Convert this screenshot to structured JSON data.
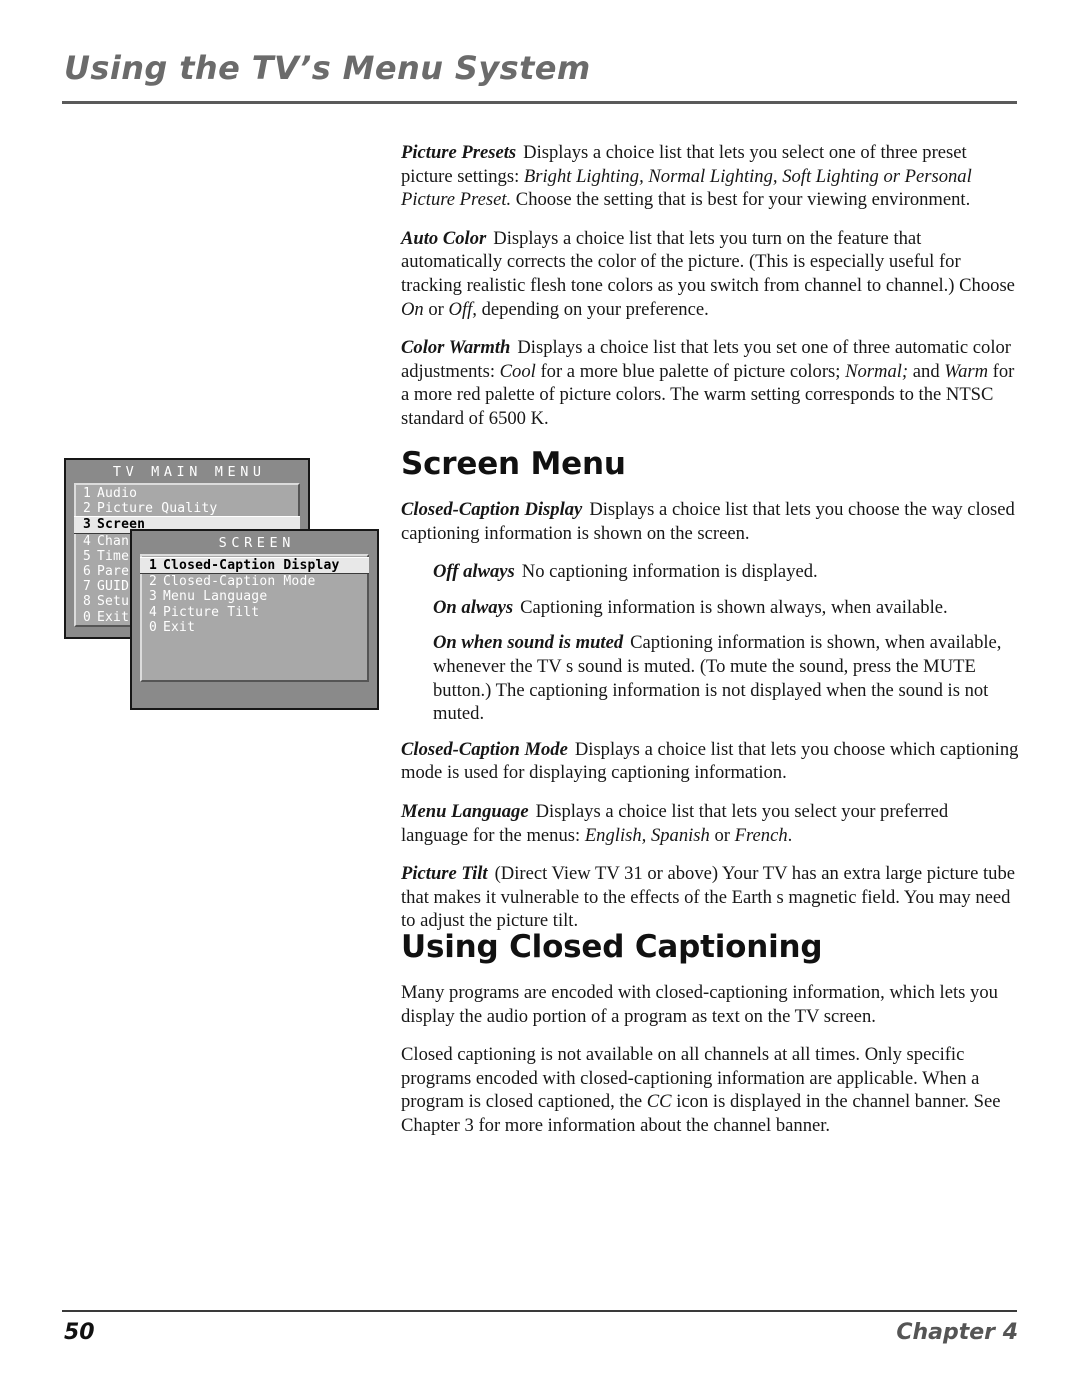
{
  "header": {
    "running_title": "Using the TV’s Menu System"
  },
  "intro_paragraphs": [
    {
      "lead": "Picture Presets",
      "runs": [
        {
          "text": "Displays a choice list that lets you select one of three preset picture settings: ",
          "style": "normal"
        },
        {
          "text": "Bright Lighting, Normal Lighting, Soft Lighting or Personal Picture Preset.",
          "style": "italic"
        },
        {
          "text": " Choose the setting that is best for your viewing environment.",
          "style": "normal"
        }
      ]
    },
    {
      "lead": "Auto Color",
      "runs": [
        {
          "text": "Displays a choice list that lets you turn on the feature that automatically corrects the color of the picture. (This is especially useful for tracking realistic flesh tone colors as you switch from channel to channel.) Choose ",
          "style": "normal"
        },
        {
          "text": "On",
          "style": "italic"
        },
        {
          "text": " or ",
          "style": "normal"
        },
        {
          "text": "Off,",
          "style": "italic"
        },
        {
          "text": " depending on your preference.",
          "style": "normal"
        }
      ]
    },
    {
      "lead": "Color Warmth",
      "runs": [
        {
          "text": "Displays a choice list that lets you set one of three automatic color adjustments: ",
          "style": "normal"
        },
        {
          "text": "Cool",
          "style": "italic"
        },
        {
          "text": " for a more blue palette of picture colors; ",
          "style": "normal"
        },
        {
          "text": "Normal;",
          "style": "italic"
        },
        {
          "text": " and ",
          "style": "normal"
        },
        {
          "text": "Warm",
          "style": "italic"
        },
        {
          "text": " for a more red palette of picture colors. The warm setting corresponds to the NTSC standard of 6500 K.",
          "style": "normal"
        }
      ]
    }
  ],
  "tv_graphic": {
    "main_menu": {
      "title": "TV MAIN MENU",
      "items": [
        {
          "num": "1",
          "label": "Audio",
          "selected": false
        },
        {
          "num": "2",
          "label": "Picture Quality",
          "selected": false
        },
        {
          "num": "3",
          "label": "Screen",
          "selected": true
        },
        {
          "num": "4",
          "label": "Channel",
          "selected": false
        },
        {
          "num": "5",
          "label": "Time",
          "selected": false
        },
        {
          "num": "6",
          "label": "Parental",
          "selected": false
        },
        {
          "num": "7",
          "label": "GUIDE Plus+",
          "selected": false
        },
        {
          "num": "8",
          "label": "Setup",
          "selected": false
        },
        {
          "num": "0",
          "label": "Exit",
          "selected": false
        }
      ]
    },
    "screen_menu": {
      "title": "SCREEN",
      "items": [
        {
          "num": "1",
          "label": "Closed-Caption Display",
          "selected": true
        },
        {
          "num": "2",
          "label": "Closed-Caption Mode",
          "selected": false
        },
        {
          "num": "3",
          "label": "Menu Language",
          "selected": false
        },
        {
          "num": "4",
          "label": "Picture Tilt",
          "selected": false
        },
        {
          "num": "0",
          "label": "Exit",
          "selected": false
        }
      ]
    },
    "colors": {
      "window_bg": "#8a8a8a",
      "list_bg": "#a8a8a8",
      "selected_bg": "#e8e8e8",
      "text": "#ffffff",
      "border": "#171717"
    }
  },
  "screen_section": {
    "heading": "Screen Menu",
    "paragraphs": [
      {
        "lead": "Closed-Caption Display",
        "runs": [
          {
            "text": "Displays a choice list that lets you choose the way closed captioning information is shown on the screen.",
            "style": "normal"
          }
        ]
      }
    ],
    "options": [
      {
        "lead": "Off always",
        "runs": [
          {
            "text": "No captioning information is displayed.",
            "style": "normal"
          }
        ]
      },
      {
        "lead": "On always",
        "runs": [
          {
            "text": "Captioning information is shown always, when available.",
            "style": "normal"
          }
        ]
      },
      {
        "lead": "On when sound is muted",
        "runs": [
          {
            "text": "Captioning information is shown, when available, whenever the TV s sound is muted. (To mute the sound, press the MUTE button.) The captioning information is not displayed when the sound is not muted.",
            "style": "normal"
          }
        ]
      }
    ],
    "more_paragraphs": [
      {
        "lead": "Closed-Caption Mode",
        "runs": [
          {
            "text": "Displays a choice list that lets you choose which captioning mode is used for displaying captioning information.",
            "style": "normal"
          }
        ]
      },
      {
        "lead": "Menu Language",
        "runs": [
          {
            "text": "Displays a choice list that lets you select your preferred language for the menus: ",
            "style": "normal"
          },
          {
            "text": "English, Spanish",
            "style": "italic"
          },
          {
            "text": " or ",
            "style": "normal"
          },
          {
            "text": "French",
            "style": "italic"
          },
          {
            "text": ".",
            "style": "normal"
          }
        ]
      },
      {
        "lead": "Picture Tilt",
        "runs": [
          {
            "text": "(Direct View TV 31  or above) Your TV has an extra large picture tube that makes it vulnerable to the effects of the Earth s magnetic field. You may need to adjust the picture tilt.",
            "style": "normal"
          }
        ]
      }
    ]
  },
  "captioning_section": {
    "heading": "Using Closed Captioning",
    "paragraphs": [
      {
        "runs": [
          {
            "text": "Many programs are encoded with closed-captioning information, which lets you display the audio portion of a program as text on the TV screen.",
            "style": "normal"
          }
        ]
      },
      {
        "runs": [
          {
            "text": "Closed captioning is not available on all channels at all times. Only specific programs encoded with closed-captioning information are applicable. When a program is closed captioned, the ",
            "style": "normal"
          },
          {
            "text": "CC",
            "style": "italic"
          },
          {
            "text": " icon is displayed in the channel banner. See Chapter 3 for more information about the channel banner.",
            "style": "normal"
          }
        ]
      }
    ]
  },
  "footer": {
    "page_number": "50",
    "chapter": "Chapter 4"
  }
}
